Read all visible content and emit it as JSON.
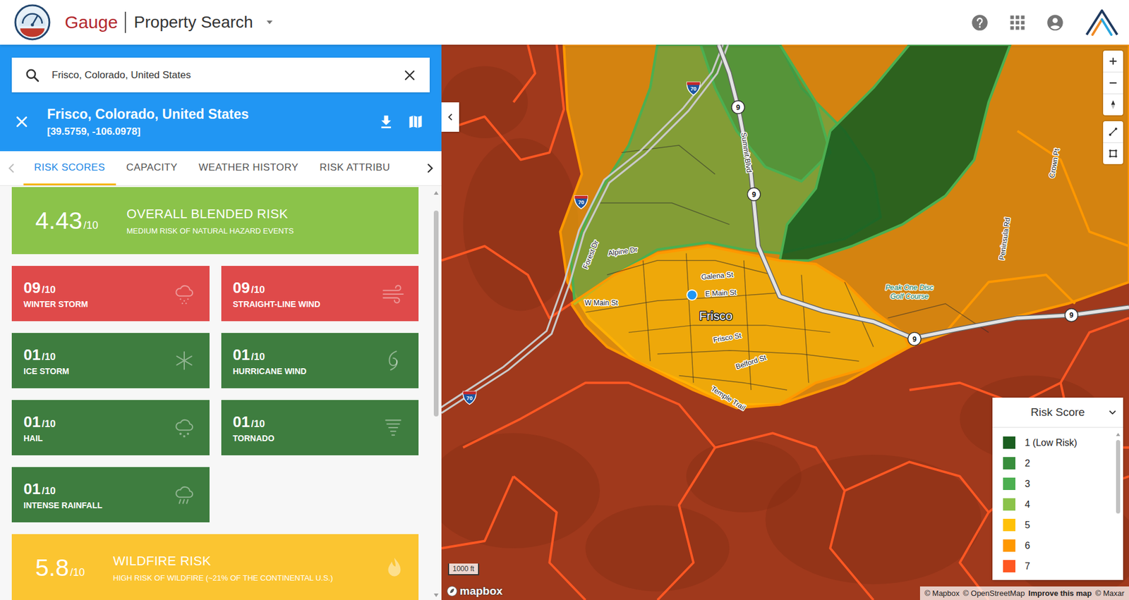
{
  "header": {
    "brand": "Gauge",
    "product": "Property Search"
  },
  "search": {
    "value": "Frisco, Colorado, United States"
  },
  "location": {
    "title": "Frisco, Colorado, United States",
    "coordinates": "[39.5759, -106.0978]"
  },
  "tabs": [
    {
      "label": "RISK SCORES",
      "selected": true
    },
    {
      "label": "CAPACITY",
      "selected": false
    },
    {
      "label": "WEATHER HISTORY",
      "selected": false
    },
    {
      "label": "RISK ATTRIBU",
      "selected": false
    }
  ],
  "overall": {
    "score": "4.43",
    "scale": "/10",
    "title": "OVERALL BLENDED RISK",
    "subtitle": "MEDIUM RISK OF NATURAL HAZARD EVENTS",
    "color": "#8bc34a"
  },
  "hazards": [
    {
      "score": "09",
      "scale": "/10",
      "label": "WINTER STORM",
      "color": "#df4a4a"
    },
    {
      "score": "09",
      "scale": "/10",
      "label": "STRAIGHT-LINE WIND",
      "color": "#df4a4a"
    },
    {
      "score": "01",
      "scale": "/10",
      "label": "ICE STORM",
      "color": "#3e7d3f"
    },
    {
      "score": "01",
      "scale": "/10",
      "label": "HURRICANE WIND",
      "color": "#3e7d3f"
    },
    {
      "score": "01",
      "scale": "/10",
      "label": "HAIL",
      "color": "#3e7d3f"
    },
    {
      "score": "01",
      "scale": "/10",
      "label": "TORNADO",
      "color": "#3e7d3f"
    },
    {
      "score": "01",
      "scale": "/10",
      "label": "INTENSE RAINFALL",
      "color": "#3e7d3f"
    }
  ],
  "wildfire": {
    "score": "5.8",
    "scale": "/10",
    "title": "WILDFIRE RISK",
    "subtitle": "HIGH RISK OF WILDFIRE (~21% OF THE CONTINENTAL U.S.)",
    "color": "#fbc531"
  },
  "map": {
    "labels": [
      {
        "text": "Summit Blvd",
        "kind": "street"
      },
      {
        "text": "Alpine Dr",
        "kind": "street"
      },
      {
        "text": "Forest Dr",
        "kind": "street"
      },
      {
        "text": "Galena St",
        "kind": "street"
      },
      {
        "text": "W Main St",
        "kind": "street"
      },
      {
        "text": "E Main St",
        "kind": "street"
      },
      {
        "text": "Frisco",
        "kind": "place"
      },
      {
        "text": "Frisco St",
        "kind": "street"
      },
      {
        "text": "Belford St",
        "kind": "street"
      },
      {
        "text": "Temple Trail",
        "kind": "street"
      },
      {
        "text": "Peak One Disc",
        "kind": "poi"
      },
      {
        "text": "Golf Course",
        "kind": "poi"
      },
      {
        "text": "Peninsula Rd",
        "kind": "street"
      },
      {
        "text": "Crown Pt",
        "kind": "street"
      }
    ],
    "shields": [
      {
        "text": "70",
        "kind": "interstate"
      },
      {
        "text": "70",
        "kind": "interstate"
      },
      {
        "text": "70",
        "kind": "interstate"
      },
      {
        "text": "9",
        "kind": "state"
      },
      {
        "text": "9",
        "kind": "state"
      },
      {
        "text": "9",
        "kind": "state"
      },
      {
        "text": "9",
        "kind": "state"
      }
    ],
    "scale": "1000 ft",
    "logo": "mapbox",
    "attribution": [
      {
        "text": "© Mapbox",
        "bold": false
      },
      {
        "text": "© OpenStreetMap",
        "bold": false
      },
      {
        "text": "Improve this map",
        "bold": true
      },
      {
        "text": "© Maxar",
        "bold": false
      }
    ]
  },
  "legend": {
    "title": "Risk Score",
    "items": [
      {
        "label": "1 (Low Risk)",
        "color": "#1b5e20"
      },
      {
        "label": "2",
        "color": "#388e3c"
      },
      {
        "label": "3",
        "color": "#4caf50"
      },
      {
        "label": "4",
        "color": "#8bc34a"
      },
      {
        "label": "5",
        "color": "#ffc107"
      },
      {
        "label": "6",
        "color": "#ff9800"
      },
      {
        "label": "7",
        "color": "#ff5722"
      }
    ]
  }
}
